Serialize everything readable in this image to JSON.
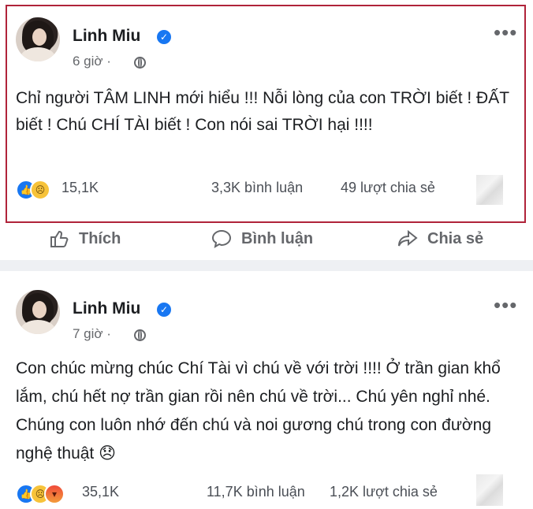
{
  "post1": {
    "author": "Linh Miu",
    "time": "6 giờ ·",
    "content": "Chỉ người TÂM LINH mới hiểu  !!! Nỗi lòng của con TRỜI biết ! ĐẤT biết ! Chú CHÍ TÀI biết ! Con nói sai TRỜI hại !!!!",
    "reaction_count": "15,1K",
    "comments": "3,3K bình luận",
    "shares": "49 lượt chia sẻ",
    "reactions": [
      "like-icon",
      "sad-icon"
    ]
  },
  "actions": {
    "like": "Thích",
    "comment": "Bình luận",
    "share": "Chia sẻ"
  },
  "post2": {
    "author": "Linh Miu",
    "time": "7 giờ ·",
    "content": "Con chúc mừng chúc Chí Tài vì chú về với trời !!!! Ở trần gian khổ lắm, chú hết nợ trần gian rồi nên chú về trời... Chú yên nghỉ nhé. Chúng con luôn nhớ đến chú và noi gương chú trong con đường nghệ thuật 😞",
    "reaction_count": "35,1K",
    "comments": "11,7K bình luận",
    "shares": "1,2K lượt chia sẻ",
    "reactions": [
      "like-icon",
      "sad-icon",
      "angry-icon"
    ]
  },
  "colors": {
    "highlight_border": "#b0233a",
    "verified": "#1877f2",
    "meta_text": "#65676b",
    "divider": "#eef0f3"
  }
}
